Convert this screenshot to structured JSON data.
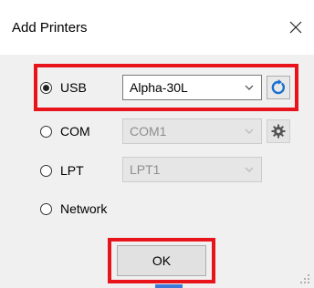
{
  "dialog": {
    "title": "Add Printers"
  },
  "ports": [
    {
      "label": "USB",
      "selected": true,
      "device": "Alpha-30L",
      "enabled": true,
      "action_icon": "refresh-icon"
    },
    {
      "label": "COM",
      "selected": false,
      "device": "COM1",
      "enabled": false,
      "action_icon": "gear-icon"
    },
    {
      "label": "LPT",
      "selected": false,
      "device": "LPT1",
      "enabled": false
    },
    {
      "label": "Network",
      "selected": false
    }
  ],
  "ok_label": "OK",
  "colors": {
    "highlight": "#e8141c",
    "refresh": "#1a6fd0",
    "content_bg": "#f0f0f0"
  }
}
